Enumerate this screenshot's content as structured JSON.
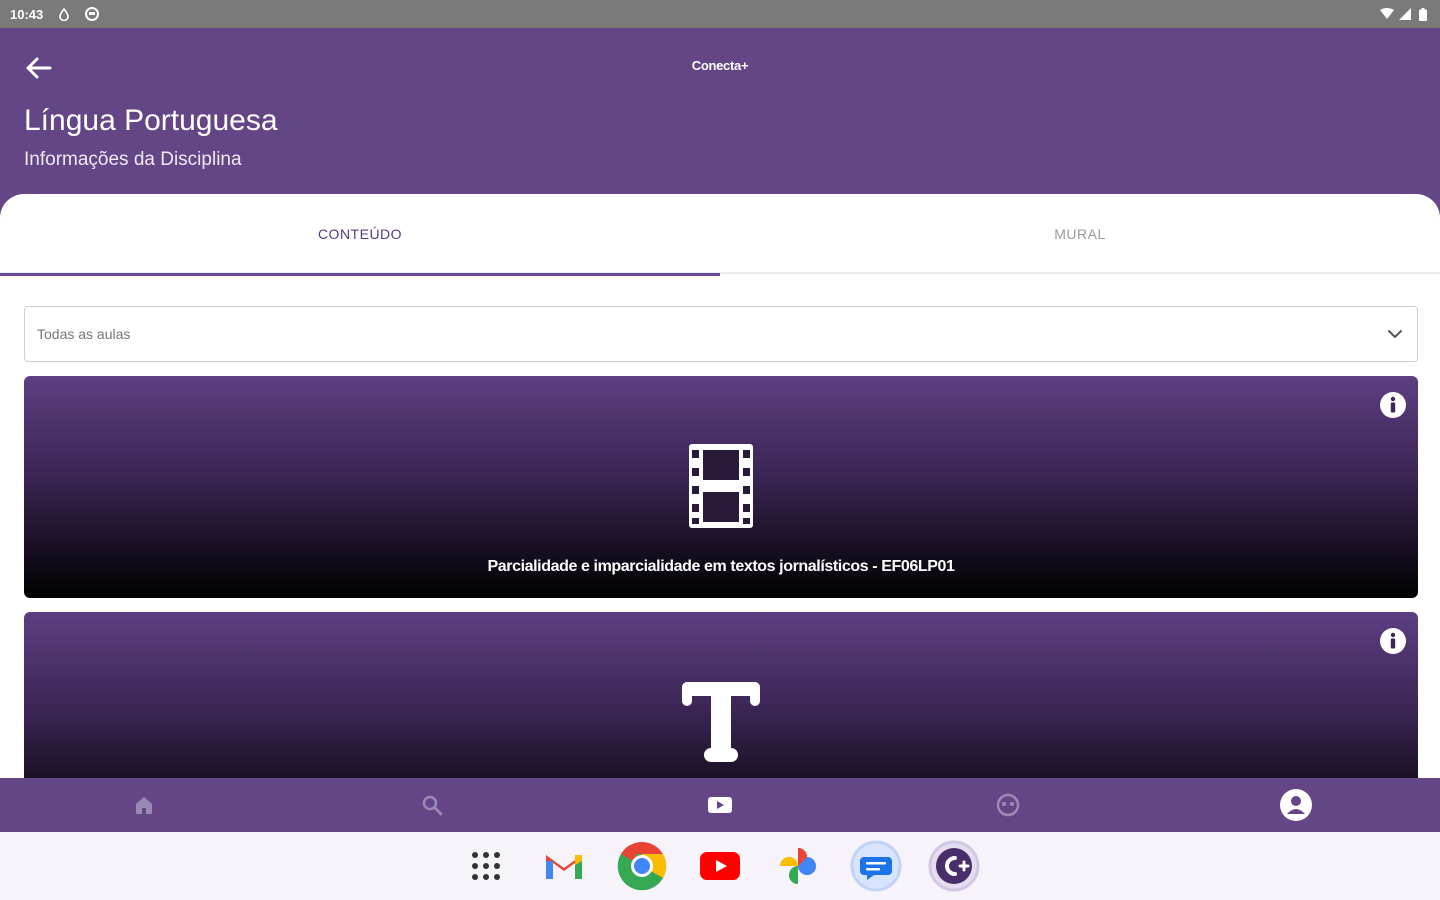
{
  "status_bar": {
    "time": "10:43"
  },
  "header": {
    "app_name": "Conecta+",
    "title": "Língua Portuguesa",
    "subtitle": "Informações da Disciplina"
  },
  "tabs": [
    {
      "label": "CONTEÚDO",
      "active": true
    },
    {
      "label": "MURAL",
      "active": false
    }
  ],
  "lesson_filter": {
    "selected": "Todas as aulas"
  },
  "cards": [
    {
      "type_icon": "film-icon",
      "title": "Parcialidade e imparcialidade em textos jornalísticos - EF06LP01"
    },
    {
      "type_icon": "text-icon",
      "title": ""
    }
  ],
  "bottom_nav": [
    "home-icon",
    "search-icon",
    "video-icon",
    "explore-icon",
    "account-icon"
  ],
  "dock_apps": [
    "app-drawer-icon",
    "gmail-icon",
    "chrome-icon",
    "youtube-icon",
    "photos-icon",
    "messages-icon",
    "conecta-icon"
  ],
  "colors": {
    "primary": "#644686",
    "tab_accent": "#6a4a94",
    "status_bar": "#7a7a7a"
  }
}
